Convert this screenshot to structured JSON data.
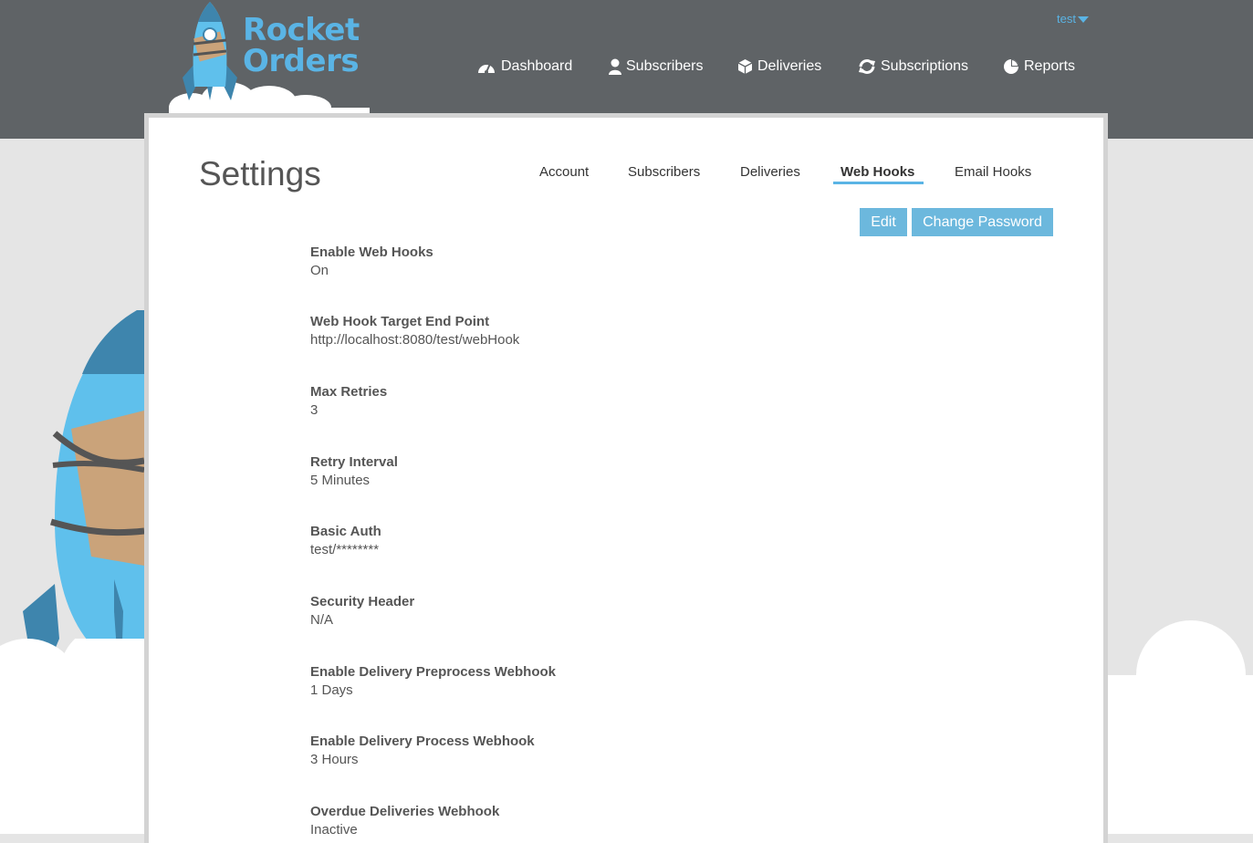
{
  "brand": {
    "line1": "Rocket",
    "line2": "Orders",
    "color": "#5ab4e5"
  },
  "user_menu": {
    "label": "test"
  },
  "nav": [
    {
      "label": "Dashboard",
      "icon": "dashboard-gauge-icon"
    },
    {
      "label": "Subscribers",
      "icon": "person-icon"
    },
    {
      "label": "Deliveries",
      "icon": "box-icon"
    },
    {
      "label": "Subscriptions",
      "icon": "refresh-icon"
    },
    {
      "label": "Reports",
      "icon": "pie-chart-icon"
    }
  ],
  "page": {
    "title": "Settings"
  },
  "tabs": [
    {
      "label": "Account",
      "active": false
    },
    {
      "label": "Subscribers",
      "active": false
    },
    {
      "label": "Deliveries",
      "active": false
    },
    {
      "label": "Web Hooks",
      "active": true
    },
    {
      "label": "Email Hooks",
      "active": false
    }
  ],
  "actions": {
    "edit": "Edit",
    "change_password": "Change Password"
  },
  "fields": [
    {
      "label": "Enable Web Hooks",
      "value": "On"
    },
    {
      "label": "Web Hook Target End Point",
      "value": "http://localhost:8080/test/webHook"
    },
    {
      "label": "Max Retries",
      "value": "3"
    },
    {
      "label": "Retry Interval",
      "value": "5 Minutes"
    },
    {
      "label": "Basic Auth",
      "value": "test/********"
    },
    {
      "label": "Security Header",
      "value": "N/A"
    },
    {
      "label": "Enable Delivery Preprocess Webhook",
      "value": "1 Days"
    },
    {
      "label": "Enable Delivery Process Webhook",
      "value": "3 Hours"
    },
    {
      "label": "Overdue Deliveries Webhook",
      "value": "Inactive"
    }
  ],
  "colors": {
    "header": "#5f6366",
    "accent": "#5ab4e5",
    "button": "#6cb8dd",
    "background": "#e5e5e5"
  }
}
